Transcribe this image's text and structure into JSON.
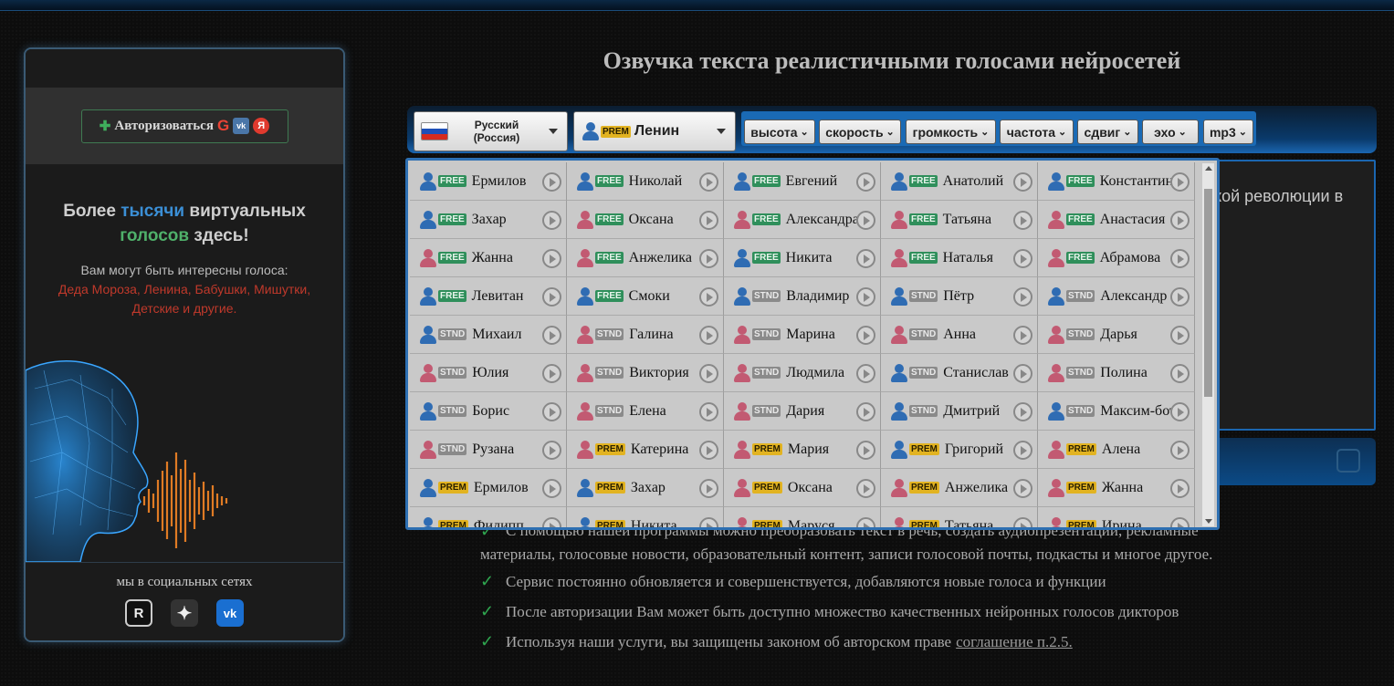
{
  "sidebar": {
    "auth_label": "Авторизоваться",
    "auth_vk": "vk",
    "auth_ya": "Я",
    "promo_title_a": "Более ",
    "promo_title_b": "тысячи",
    "promo_title_c": " виртуальных",
    "promo_title_d": "голосов",
    "promo_title_e": " здесь!",
    "promo_sub": "Вам могут быть интересны голоса:",
    "promo_links": "Деда Мороза, Ленина, Бабушки, Мишутки, Детские и другие.",
    "social_label": "мы в социальных сетях",
    "social_icons": [
      "rutube-icon",
      "dzen-icon",
      "vk-icon"
    ]
  },
  "main": {
    "title": "Озвучка текста реалистичными голосами нейросетей",
    "language": {
      "line1": "Русский",
      "line2": "(Россия)"
    },
    "selected_voice": {
      "name": "Ленин",
      "tier": "PREM"
    },
    "params": [
      "высота",
      "скорость",
      "громкость",
      "частота",
      "сдвиг",
      "эхо",
      "mp3"
    ],
    "textarea_visible": "кой революции в"
  },
  "voices": [
    {
      "name": "Ермилов",
      "gender": "m",
      "tier": "FREE"
    },
    {
      "name": "Николай",
      "gender": "m",
      "tier": "FREE"
    },
    {
      "name": "Евгений",
      "gender": "m",
      "tier": "FREE"
    },
    {
      "name": "Анатолий",
      "gender": "m",
      "tier": "FREE"
    },
    {
      "name": "Константин",
      "gender": "m",
      "tier": "FREE"
    },
    {
      "name": "Захар",
      "gender": "m",
      "tier": "FREE"
    },
    {
      "name": "Оксана",
      "gender": "f",
      "tier": "FREE"
    },
    {
      "name": "Александра",
      "gender": "f",
      "tier": "FREE"
    },
    {
      "name": "Татьяна",
      "gender": "f",
      "tier": "FREE"
    },
    {
      "name": "Анастасия",
      "gender": "f",
      "tier": "FREE"
    },
    {
      "name": "Жанна",
      "gender": "f",
      "tier": "FREE"
    },
    {
      "name": "Анжелика",
      "gender": "f",
      "tier": "FREE"
    },
    {
      "name": "Никита",
      "gender": "m",
      "tier": "FREE"
    },
    {
      "name": "Наталья",
      "gender": "f",
      "tier": "FREE"
    },
    {
      "name": "Абрамова",
      "gender": "f",
      "tier": "FREE"
    },
    {
      "name": "Левитан",
      "gender": "m",
      "tier": "FREE"
    },
    {
      "name": "Смоки",
      "gender": "m",
      "tier": "FREE"
    },
    {
      "name": "Владимир",
      "gender": "m",
      "tier": "STND"
    },
    {
      "name": "Пётр",
      "gender": "m",
      "tier": "STND"
    },
    {
      "name": "Александр",
      "gender": "m",
      "tier": "STND"
    },
    {
      "name": "Михаил",
      "gender": "m",
      "tier": "STND"
    },
    {
      "name": "Галина",
      "gender": "f",
      "tier": "STND"
    },
    {
      "name": "Марина",
      "gender": "f",
      "tier": "STND"
    },
    {
      "name": "Анна",
      "gender": "f",
      "tier": "STND"
    },
    {
      "name": "Дарья",
      "gender": "f",
      "tier": "STND"
    },
    {
      "name": "Юлия",
      "gender": "f",
      "tier": "STND"
    },
    {
      "name": "Виктория",
      "gender": "f",
      "tier": "STND"
    },
    {
      "name": "Людмила",
      "gender": "f",
      "tier": "STND"
    },
    {
      "name": "Станислав",
      "gender": "m",
      "tier": "STND"
    },
    {
      "name": "Полина",
      "gender": "f",
      "tier": "STND"
    },
    {
      "name": "Борис",
      "gender": "m",
      "tier": "STND"
    },
    {
      "name": "Елена",
      "gender": "f",
      "tier": "STND"
    },
    {
      "name": "Дария",
      "gender": "f",
      "tier": "STND"
    },
    {
      "name": "Дмитрий",
      "gender": "m",
      "tier": "STND"
    },
    {
      "name": "Максим-бот",
      "gender": "m",
      "tier": "STND"
    },
    {
      "name": "Рузана",
      "gender": "f",
      "tier": "STND"
    },
    {
      "name": "Катерина",
      "gender": "f",
      "tier": "PREM"
    },
    {
      "name": "Мария",
      "gender": "f",
      "tier": "PREM"
    },
    {
      "name": "Григорий",
      "gender": "m",
      "tier": "PREM"
    },
    {
      "name": "Алена",
      "gender": "f",
      "tier": "PREM"
    },
    {
      "name": "Ермилов",
      "gender": "m",
      "tier": "PREM"
    },
    {
      "name": "Захар",
      "gender": "m",
      "tier": "PREM"
    },
    {
      "name": "Оксана",
      "gender": "f",
      "tier": "PREM"
    },
    {
      "name": "Анжелика",
      "gender": "f",
      "tier": "PREM"
    },
    {
      "name": "Жанна",
      "gender": "f",
      "tier": "PREM"
    },
    {
      "name": "Филипп",
      "gender": "m",
      "tier": "PREM"
    },
    {
      "name": "Никита",
      "gender": "m",
      "tier": "PREM"
    },
    {
      "name": "Маруся",
      "gender": "f",
      "tier": "PREM"
    },
    {
      "name": "Татьяна",
      "gender": "f",
      "tier": "PREM"
    },
    {
      "name": "Ирина",
      "gender": "f",
      "tier": "PREM"
    }
  ],
  "features": {
    "line1_visible": "С помощью нашей программы можно преобразовать текст в речь, создать аудиопрезентации, рекламные",
    "line1_cont": "материалы, голосовые новости, образовательный контент, записи голосовой почты, подкасты и многое другое.",
    "line2": "Сервис постоянно обновляется и совершенствуется, добавляются новые голоса и функции",
    "line3": "После авторизации Вам может быть доступно множество качественных нейронных голосов дикторов",
    "line4": "Используя наши услуги, вы защищены законом об авторском праве",
    "agreement_link": "соглашение п.2.5.",
    "check_mark": "✓"
  }
}
